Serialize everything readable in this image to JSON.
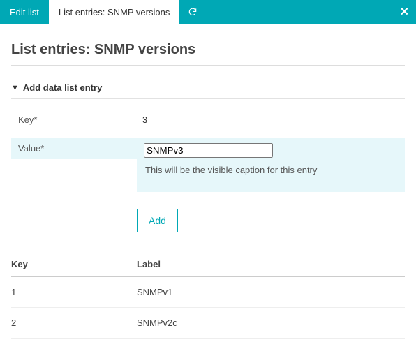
{
  "colors": {
    "accent": "#00a8b5",
    "highlight": "#e6f7fa"
  },
  "tabs": {
    "edit_list": "Edit list",
    "entries": "List entries: SNMP versions"
  },
  "page_title": "List entries: SNMP versions",
  "section_title": "Add data list entry",
  "form": {
    "key_label": "Key*",
    "key_value": "3",
    "value_label": "Value*",
    "value_value": "SNMPv3",
    "value_help": "This will be the visible caption for this entry",
    "add_label": "Add"
  },
  "table": {
    "headers": {
      "key": "Key",
      "label": "Label"
    },
    "rows": [
      {
        "key": "1",
        "label": "SNMPv1"
      },
      {
        "key": "2",
        "label": "SNMPv2c"
      }
    ]
  }
}
